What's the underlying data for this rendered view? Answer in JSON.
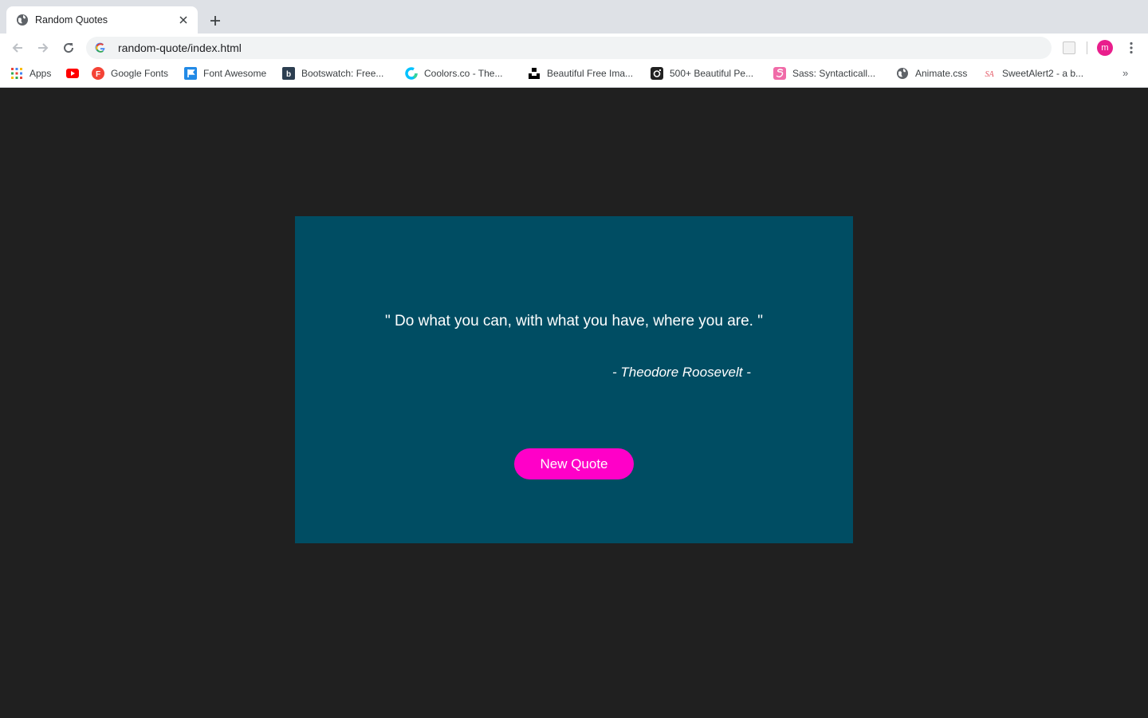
{
  "browser": {
    "tab_title": "Random Quotes",
    "url": "random-quote/index.html",
    "profile_initial": "m"
  },
  "bookmarks": [
    {
      "label": "Apps",
      "icon": "apps-grid-icon"
    },
    {
      "label": "",
      "icon": "youtube-icon"
    },
    {
      "label": "Google Fonts",
      "icon": "google-fonts-icon"
    },
    {
      "label": "Font Awesome",
      "icon": "font-awesome-icon"
    },
    {
      "label": "Bootswatch: Free...",
      "icon": "bootswatch-icon"
    },
    {
      "label": "Coolors.co - The...",
      "icon": "coolors-icon"
    },
    {
      "label": "Beautiful Free Ima...",
      "icon": "unsplash-icon"
    },
    {
      "label": "500+ Beautiful Pe...",
      "icon": "camera-icon"
    },
    {
      "label": "Sass: Syntacticall...",
      "icon": "sass-icon"
    },
    {
      "label": "Animate.css",
      "icon": "globe-icon"
    },
    {
      "label": "SweetAlert2 - a b...",
      "icon": "sweetalert-icon"
    }
  ],
  "page": {
    "quote": "\" Do what you can, with what you have, where you are. \"",
    "author": "- Theodore Roosevelt -",
    "button_label": "New Quote"
  },
  "colors": {
    "page_background": "#202020",
    "card_background": "#004d63",
    "button_background": "#ff00c8",
    "text": "#ffffff"
  }
}
